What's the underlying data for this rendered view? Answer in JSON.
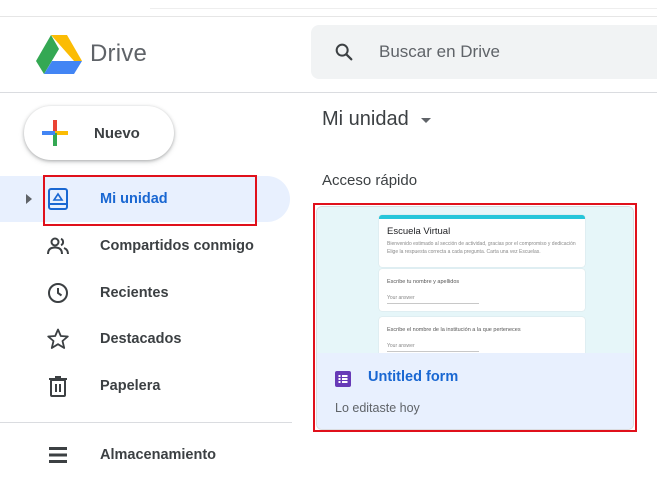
{
  "app": {
    "name": "Drive"
  },
  "search": {
    "placeholder": "Buscar en Drive"
  },
  "new_button": {
    "label": "Nuevo"
  },
  "sidebar": {
    "items": [
      {
        "label": "Mi unidad",
        "icon": "drive-icon",
        "active": true
      },
      {
        "label": "Compartidos conmigo",
        "icon": "people-icon"
      },
      {
        "label": "Recientes",
        "icon": "clock-icon"
      },
      {
        "label": "Destacados",
        "icon": "star-icon"
      },
      {
        "label": "Papelera",
        "icon": "trash-icon"
      }
    ],
    "storage": {
      "label": "Almacenamiento",
      "icon": "storage-icon"
    }
  },
  "main": {
    "title": "Mi unidad",
    "quick_access_label": "Acceso rápido",
    "quick_access": [
      {
        "name": "Untitled form",
        "subtitle": "Lo editaste hoy",
        "icon": "forms-icon",
        "preview": {
          "title": "Escuela Virtual",
          "description_line1": "Bienvenido estimado al sección de actividad, gracias por el compromiso y dedicación",
          "description_line2": "Elige la respuesta correcta a cada pregunta. Carta una vez Escuelas.",
          "question1": "Escribe tu nombre y apellidos",
          "question2": "Escribe el nombre de la institución a la que perteneces",
          "answer_placeholder": "Your answer"
        }
      }
    ]
  },
  "colors": {
    "accent": "#1967d2",
    "active_bg": "#e8f0fe",
    "highlight_box": "#e0101b",
    "forms_purple": "#673ab7"
  }
}
